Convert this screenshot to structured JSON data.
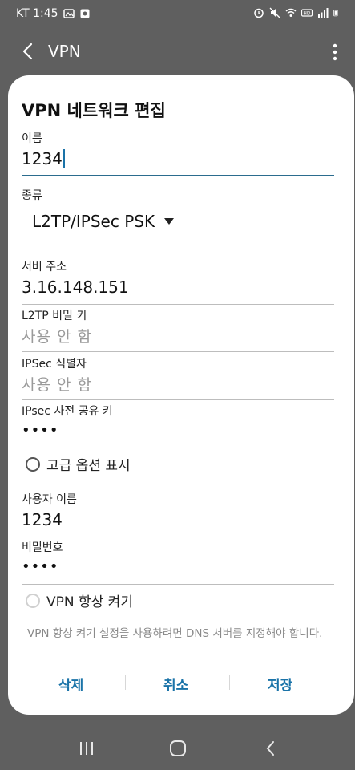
{
  "status": {
    "time": "KT 1:45"
  },
  "appbar": {
    "title": "VPN"
  },
  "dialog": {
    "title": "VPN 네트워크 편집",
    "name": {
      "label": "이름",
      "value": "1234"
    },
    "type": {
      "label": "종류",
      "value": "L2TP/IPSec PSK"
    },
    "server": {
      "label": "서버 주소",
      "value": "3.16.148.151"
    },
    "l2tp_key": {
      "label": "L2TP 비밀 키",
      "placeholder": "사용 안 함"
    },
    "ipsec_id": {
      "label": "IPSec 식별자",
      "placeholder": "사용 안 함"
    },
    "ipsec_psk": {
      "label": "IPsec 사전 공유 키",
      "value": "••••"
    },
    "advanced": {
      "label": "고급 옵션 표시",
      "checked": false
    },
    "username": {
      "label": "사용자 이름",
      "value": "1234"
    },
    "password": {
      "label": "비밀번호",
      "value": "••••"
    },
    "always_on": {
      "label": "VPN 항상 켜기",
      "checked": false
    },
    "note": "VPN 항상 켜기 설정을 사용하려면 DNS 서버를 지정해야 합니다.",
    "buttons": {
      "delete": "삭제",
      "cancel": "취소",
      "save": "저장"
    }
  },
  "colors": {
    "accent": "#1a73a8",
    "scrim": "#5f5f5f"
  }
}
